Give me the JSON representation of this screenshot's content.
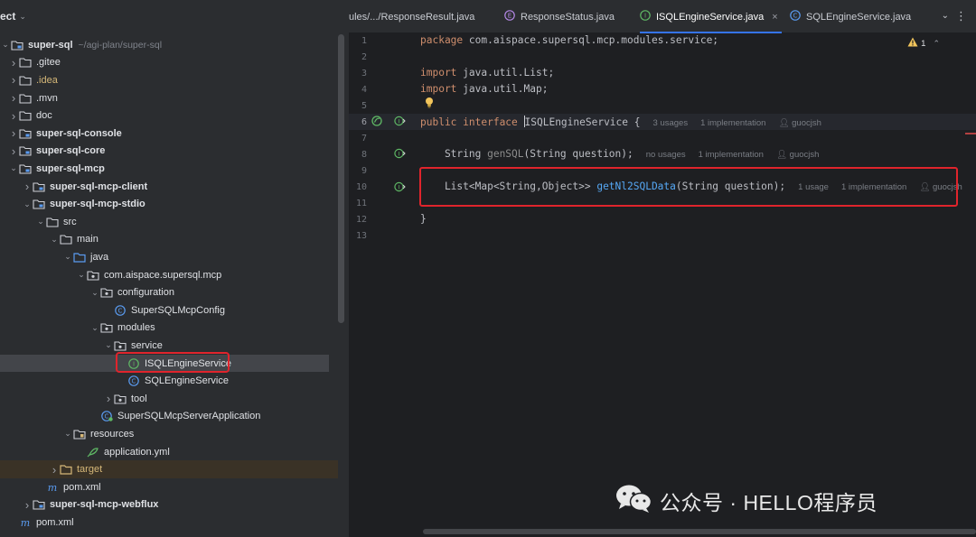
{
  "project_panel": {
    "title": "ect",
    "tree": [
      {
        "label": "super-sql",
        "path": "~/agi-plan/super-sql",
        "icon": "module-folder-icon",
        "bold": true,
        "expanded": true
      },
      {
        "label": ".gitee",
        "icon": "folder-icon"
      },
      {
        "label": ".idea",
        "icon": "folder-icon",
        "color": "gold"
      },
      {
        "label": ".mvn",
        "icon": "folder-icon"
      },
      {
        "label": "doc",
        "icon": "folder-icon"
      },
      {
        "label": "super-sql-console",
        "icon": "module-folder-icon",
        "bold": true
      },
      {
        "label": "super-sql-core",
        "icon": "module-folder-icon",
        "bold": true
      },
      {
        "label": "super-sql-mcp",
        "icon": "module-folder-icon",
        "bold": true,
        "expanded": true
      },
      {
        "label": "super-sql-mcp-client",
        "icon": "module-folder-icon",
        "bold": true
      },
      {
        "label": "super-sql-mcp-stdio",
        "icon": "module-folder-icon",
        "bold": true,
        "expanded": true
      },
      {
        "label": "src",
        "icon": "folder-icon",
        "expanded": true
      },
      {
        "label": "main",
        "icon": "folder-icon",
        "expanded": true
      },
      {
        "label": "java",
        "icon": "source-folder-icon",
        "expanded": true
      },
      {
        "label": "com.aispace.supersql.mcp",
        "icon": "package-icon",
        "expanded": true
      },
      {
        "label": "configuration",
        "icon": "package-icon",
        "expanded": true
      },
      {
        "label": "SuperSQLMcpConfig",
        "icon": "class-icon"
      },
      {
        "label": "modules",
        "icon": "package-icon",
        "expanded": true
      },
      {
        "label": "service",
        "icon": "package-icon",
        "expanded": true
      },
      {
        "label": "ISQLEngineService",
        "icon": "interface-icon",
        "selected": true
      },
      {
        "label": "SQLEngineService",
        "icon": "class-icon"
      },
      {
        "label": "tool",
        "icon": "package-icon"
      },
      {
        "label": "SuperSQLMcpServerApplication",
        "icon": "spring-class-icon"
      },
      {
        "label": "resources",
        "icon": "resources-folder-icon",
        "expanded": true
      },
      {
        "label": "application.yml",
        "icon": "yaml-icon"
      },
      {
        "label": "target",
        "icon": "excluded-folder-icon",
        "color": "orange"
      },
      {
        "label": "pom.xml",
        "icon": "maven-icon"
      },
      {
        "label": "super-sql-mcp-webflux",
        "icon": "module-folder-icon",
        "bold": true
      },
      {
        "label": "pom.xml",
        "icon": "maven-icon"
      }
    ]
  },
  "tabs": [
    {
      "label": "ules/.../ResponseResult.java",
      "icon": "none"
    },
    {
      "label": "ResponseStatus.java",
      "icon": "enum-icon"
    },
    {
      "label": "ISQLEngineService.java",
      "icon": "interface-icon",
      "active": true,
      "close": "×"
    },
    {
      "label": "SQLEngineService.java",
      "icon": "class-icon"
    }
  ],
  "editor": {
    "warning_count": "1",
    "line_numbers": [
      "1",
      "2",
      "3",
      "4",
      "5",
      "6",
      "7",
      "8",
      "9",
      "10",
      "11",
      "12",
      "13"
    ],
    "lines": {
      "l1_kw": "package",
      "l1_rest": " com.aispace.supersql.mcp.modules.service;",
      "l3_kw": "import",
      "l3_rest": " java.util.List;",
      "l4_kw": "import",
      "l4_rest": " java.util.Map;",
      "l6_kw1": "public",
      "l6_kw2": " interface ",
      "l6_name": "ISQLEngineService",
      "l6_brace": " {",
      "l6_hint_usages": "3 usages",
      "l6_hint_impl": "1 implementation",
      "l6_hint_author": "guocjsh",
      "l8_type": "    String ",
      "l8_name": "genSQL",
      "l8_params": "(String question);",
      "l8_hint_usages": "no usages",
      "l8_hint_impl": "1 implementation",
      "l8_hint_author": "guocjsh",
      "l10_type": "    List<Map<String,Object>> ",
      "l10_name": "getNl2SQLData",
      "l10_params": "(String question);",
      "l10_hint_usages": "1 usage",
      "l10_hint_impl": "1 implementation",
      "l10_hint_author": "guocjsh",
      "l12": "}"
    }
  },
  "watermark": {
    "text": "公众号 · HELLO程序员"
  },
  "colors": {
    "highlight_box": "#e0242c",
    "accent": "#3574f0",
    "keyword": "#cf8e6d",
    "method": "#56a8f5"
  }
}
